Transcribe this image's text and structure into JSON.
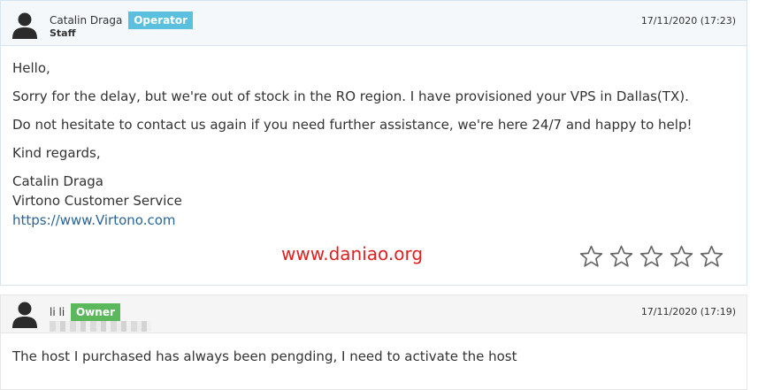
{
  "replies": [
    {
      "author": "Catalin Draga",
      "badge": "Operator",
      "role": "Staff",
      "date": "17/11/2020 (17:23)",
      "paragraphs": [
        "Hello,",
        "Sorry for the delay, but we're out of stock in the RO region. I have provisioned your VPS in Dallas(TX).",
        "Do not hesitate to contact us again if you need further assistance, we're here 24/7 and happy to help!",
        "Kind regards,"
      ],
      "signature": {
        "name": "Catalin Draga",
        "team": "Virtono Customer Service",
        "link": "https://www.Virtono.com"
      },
      "rating": {
        "max": 5,
        "value": 0
      }
    },
    {
      "author": "li li",
      "badge": "Owner",
      "date": "17/11/2020 (17:19)",
      "paragraphs": [
        "The host I purchased has always been pengding, I need to activate the host"
      ]
    }
  ],
  "watermark": "www.daniao.org",
  "colors": {
    "operator_badge": "#5bc0de",
    "owner_badge": "#5cb85c",
    "link": "#2a6496",
    "watermark": "#e02020"
  }
}
